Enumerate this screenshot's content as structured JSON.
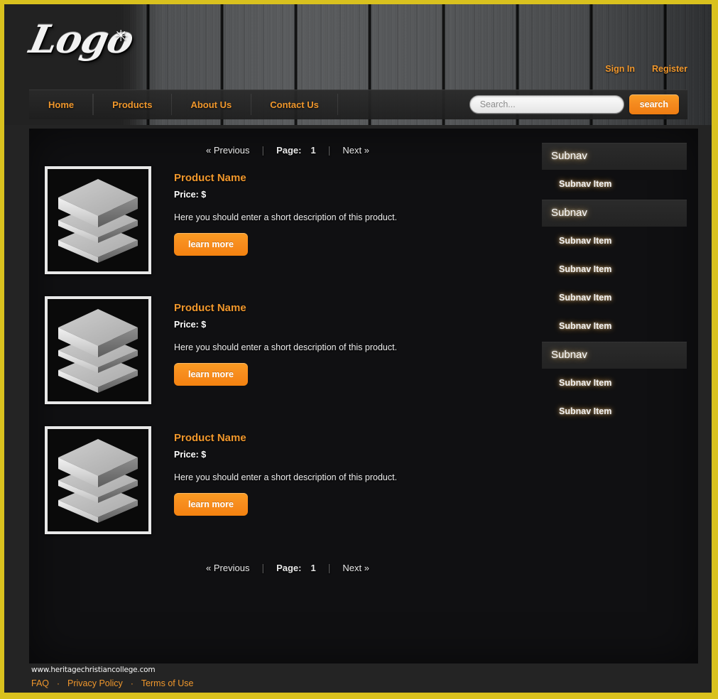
{
  "brand": {
    "logo_text": "Logo",
    "logo_star": "✳"
  },
  "account": {
    "sign_in": "Sign In",
    "register": "Register"
  },
  "nav": {
    "items": [
      {
        "label": "Home"
      },
      {
        "label": "Products"
      },
      {
        "label": "About Us"
      },
      {
        "label": "Contact Us"
      }
    ]
  },
  "search": {
    "placeholder": "Search...",
    "value": "",
    "button_label": "search"
  },
  "pagination": {
    "previous": "« Previous",
    "page_label": "Page:",
    "page_number": "1",
    "next": "Next »",
    "separator": "|"
  },
  "products": [
    {
      "title": "Product Name",
      "price": "Price: $",
      "description": "Here you should enter a short description of this product.",
      "button_label": "learn more",
      "image": "stacked-layers-icon"
    },
    {
      "title": "Product Name",
      "price": "Price: $",
      "description": "Here you should enter a short description of this product.",
      "button_label": "learn more",
      "image": "stacked-layers-icon"
    },
    {
      "title": "Product Name",
      "price": "Price: $",
      "description": "Here you should enter a short description of this product.",
      "button_label": "learn more",
      "image": "stacked-layers-icon"
    }
  ],
  "sidebar": {
    "groups": [
      {
        "header": "Subnav",
        "items": [
          {
            "label": "Subnav Item"
          }
        ]
      },
      {
        "header": "Subnav",
        "items": [
          {
            "label": "Subnav Item"
          },
          {
            "label": "Subnav Item"
          },
          {
            "label": "Subnav Item"
          },
          {
            "label": "Subnav Item"
          }
        ]
      },
      {
        "header": "Subnav",
        "items": [
          {
            "label": "Subnav Item"
          },
          {
            "label": "Subnav Item"
          }
        ]
      }
    ]
  },
  "footer": {
    "site": "www.heritagechristiancollege.com",
    "links": [
      {
        "label": "FAQ"
      },
      {
        "label": "Privacy Policy"
      },
      {
        "label": "Terms of Use"
      }
    ],
    "dot": "·"
  },
  "colors": {
    "page_border": "#d9c11e",
    "accent_orange": "#f0972c",
    "button_orange": "#f78c1e",
    "panel_bg": "#101012",
    "footer_bg": "#242424"
  }
}
